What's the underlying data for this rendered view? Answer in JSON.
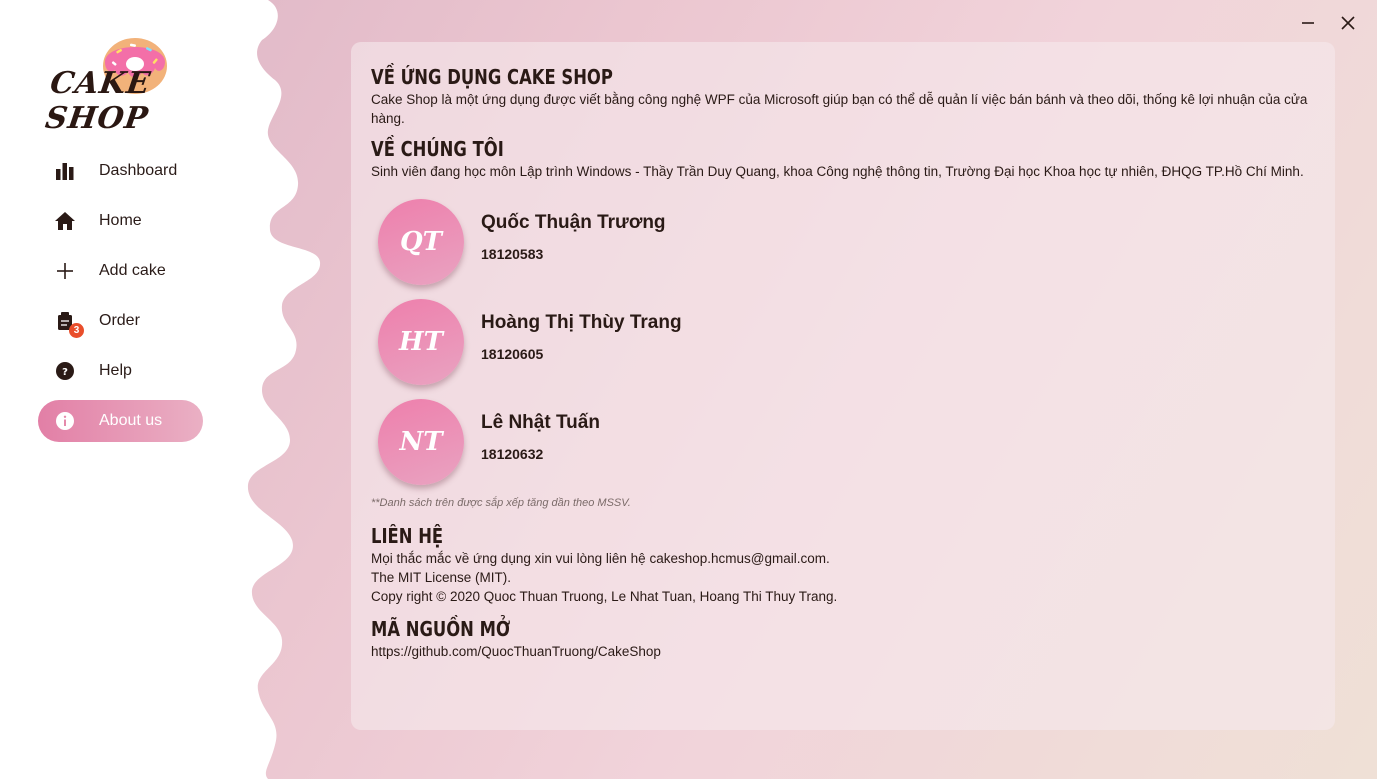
{
  "window": {
    "minimize_icon": "minimize-icon",
    "close_icon": "close-icon"
  },
  "logo": {
    "text": "CAKE SHOP",
    "icon": "donut-icon"
  },
  "sidebar": {
    "items": [
      {
        "label": "Dashboard",
        "icon": "bar-chart-icon",
        "active": false
      },
      {
        "label": "Home",
        "icon": "home-icon",
        "active": false
      },
      {
        "label": "Add cake",
        "icon": "plus-icon",
        "active": false
      },
      {
        "label": "Order",
        "icon": "order-icon",
        "badge": "3",
        "active": false
      },
      {
        "label": "Help",
        "icon": "help-icon",
        "active": false
      },
      {
        "label": "About us",
        "icon": "info-icon",
        "active": true
      }
    ]
  },
  "about": {
    "app_title": "VỀ ỨNG DỤNG CAKE SHOP",
    "app_desc": "Cake Shop là một ứng dụng được viết bằng công nghệ WPF của Microsoft giúp bạn có thể dễ quản lí việc bán bánh và theo dõi, thống kê lợi nhuận của cửa hàng.",
    "us_title": "VỀ CHÚNG TÔI",
    "us_desc": "Sinh viên đang học môn Lập trình Windows - Thầy Trần Duy Quang, khoa Công nghệ thông tin, Trường Đại học Khoa học tự nhiên, ĐHQG TP.Hồ Chí Minh.",
    "members": [
      {
        "initials": "QT",
        "name": "Quốc Thuận Trương",
        "id": "18120583"
      },
      {
        "initials": "HT",
        "name": "Hoàng Thị Thùy Trang",
        "id": "18120605"
      },
      {
        "initials": "NT",
        "name": "Lê Nhật Tuấn",
        "id": "18120632"
      }
    ],
    "note": "**Danh sách trên được sắp xếp tăng dần theo MSSV.",
    "contact_title": "LIÊN HỆ",
    "contact_lines": [
      "Mọi thắc mắc về ứng dụng xin vui lòng liên hệ cakeshop.hcmus@gmail.com.",
      "The MIT License (MIT).",
      "Copy right © 2020 Quoc Thuan Truong, Le Nhat Tuan, Hoang Thi Thuy Trang."
    ],
    "source_title": "MÃ NGUỒN MỞ",
    "source_url": "https://github.com/QuocThuanTruong/CakeShop"
  },
  "colors": {
    "accent": "#e27fa6",
    "badge": "#e94e2b",
    "text": "#2a1a16"
  }
}
